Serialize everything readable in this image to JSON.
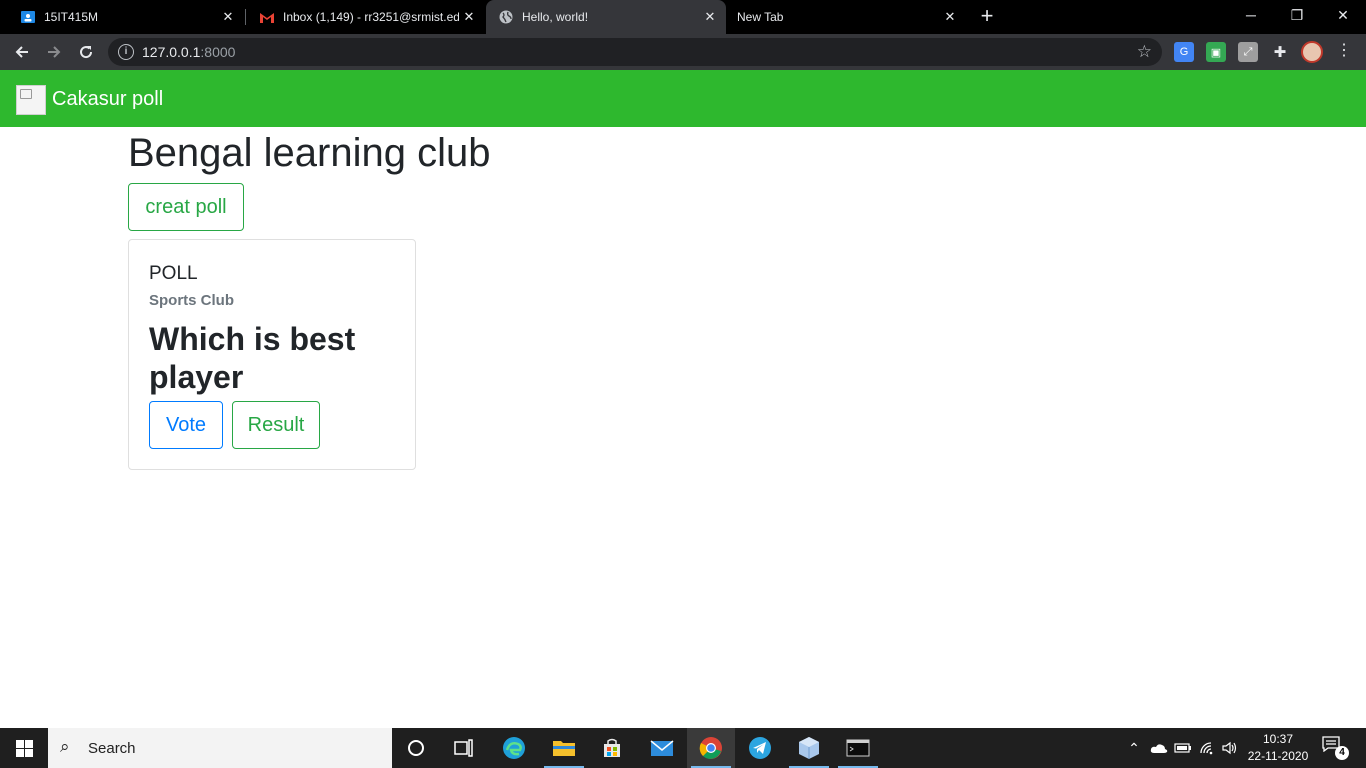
{
  "browser": {
    "tabs": [
      {
        "title": "15IT415M",
        "icon": "google-classroom-icon",
        "active": false
      },
      {
        "title": "Inbox (1,149) - rr3251@srmist.ed",
        "icon": "gmail-icon",
        "active": false
      },
      {
        "title": "Hello, world!",
        "icon": "globe-icon",
        "active": true
      },
      {
        "title": "New Tab",
        "icon": "",
        "active": false
      }
    ],
    "url_host": "127.0.0.1",
    "url_port": ":8000",
    "new_tab_glyph": "+",
    "minimize_glyph": "─",
    "restore_glyph": "❐",
    "close_glyph": "✕"
  },
  "site": {
    "brand": "Cakasur poll",
    "nav_color": "#2eb82e"
  },
  "main": {
    "title": "Bengal learning club",
    "create_button": "creat poll"
  },
  "poll_card": {
    "title": "POLL",
    "subtitle": "Sports Club",
    "question": "Which is best player",
    "vote_button": "Vote",
    "result_button": "Result"
  },
  "taskbar": {
    "search_placeholder": "Search",
    "time": "10:37",
    "date": "22-11-2020",
    "notification_count": "4",
    "apps": [
      "cortana-icon",
      "task-view-icon",
      "edge-icon",
      "file-explorer-icon",
      "store-icon",
      "mail-icon",
      "chrome-icon",
      "telegram-icon",
      "box-app-icon",
      "terminal-icon"
    ]
  },
  "colors": {
    "success": "#28a745",
    "primary": "#007bff",
    "browser_dark": "#35363a"
  }
}
